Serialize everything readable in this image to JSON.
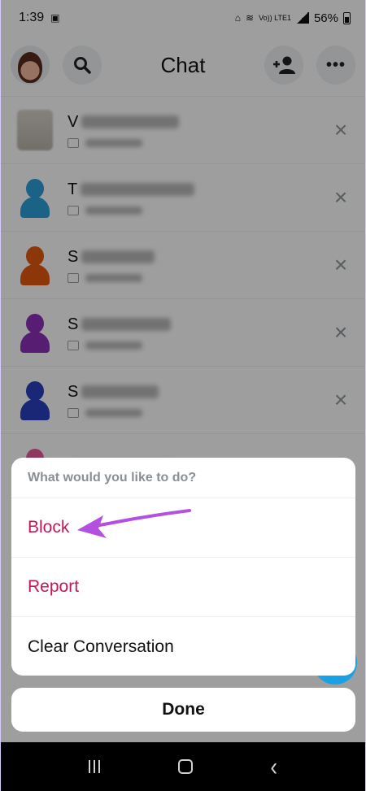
{
  "status_bar": {
    "time": "1:39",
    "network": "Vo)) LTE1",
    "battery": "56%"
  },
  "header": {
    "title": "Chat"
  },
  "chat_list": [
    {
      "initial": "V",
      "avatar": "photo",
      "color": ""
    },
    {
      "initial": "T",
      "avatar": "silhouette",
      "color": "#2a9fd8"
    },
    {
      "initial": "S",
      "avatar": "silhouette",
      "color": "#e2580f"
    },
    {
      "initial": "S",
      "avatar": "silhouette",
      "color": "#8b2fb8"
    },
    {
      "initial": "S",
      "avatar": "silhouette",
      "color": "#2a3fbf"
    },
    {
      "initial": "",
      "avatar": "silhouette",
      "color": "#e7599a"
    }
  ],
  "action_sheet": {
    "title": "What would you like to do?",
    "options": [
      {
        "label": "Block",
        "color": "#c2185b"
      },
      {
        "label": "Report",
        "color": "#c2185b"
      },
      {
        "label": "Clear Conversation",
        "color": "#111111"
      }
    ]
  },
  "done_button": "Done",
  "colors": {
    "destructive": "#c2185b",
    "annotation_arrow": "#b44fe0",
    "fab": "#1aa1e3"
  }
}
